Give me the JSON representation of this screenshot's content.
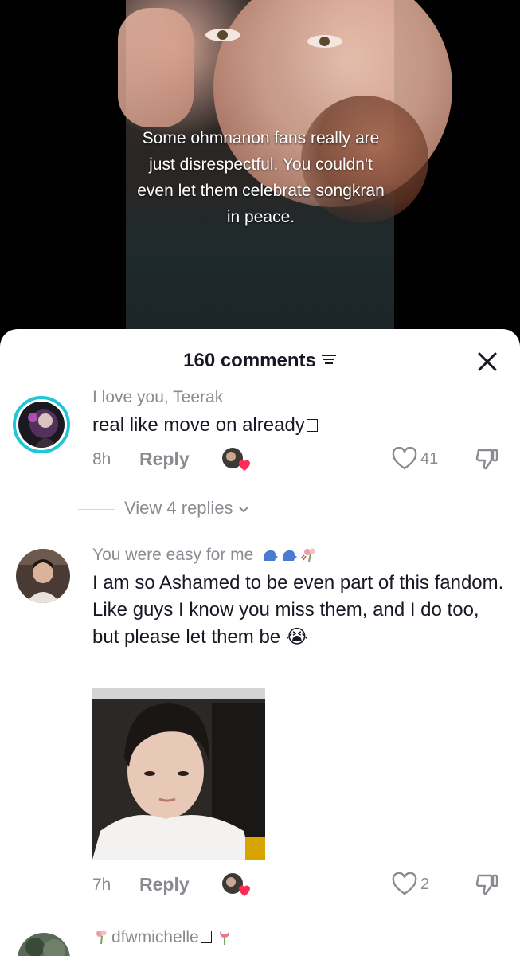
{
  "video": {
    "caption": "Some ohmnanon fans really are just disrespectful. You couldn't even let them celebrate songkran in peace."
  },
  "sheet": {
    "comments_count": "160 comments",
    "filter_icon": "filter-icon",
    "close_icon": "close-icon"
  },
  "comments": [
    {
      "username": "I love you, Teerak",
      "text": "real like move on already",
      "time": "8h",
      "reply_label": "Reply",
      "like_count": "41",
      "view_replies": "View 4 replies"
    },
    {
      "username": "You were easy for me",
      "text": "I am so Ashamed to be even part of this fandom. Like guys I know you miss them, and I do too, but please let them be",
      "emoji": "😭",
      "time": "7h",
      "reply_label": "Reply",
      "like_count": "2"
    },
    {
      "username": "dfwmichelle"
    }
  ],
  "colors": {
    "accent_teal": "#1ec7d6",
    "muted_text": "#8a8b91",
    "heart_red": "#fe2c55"
  }
}
